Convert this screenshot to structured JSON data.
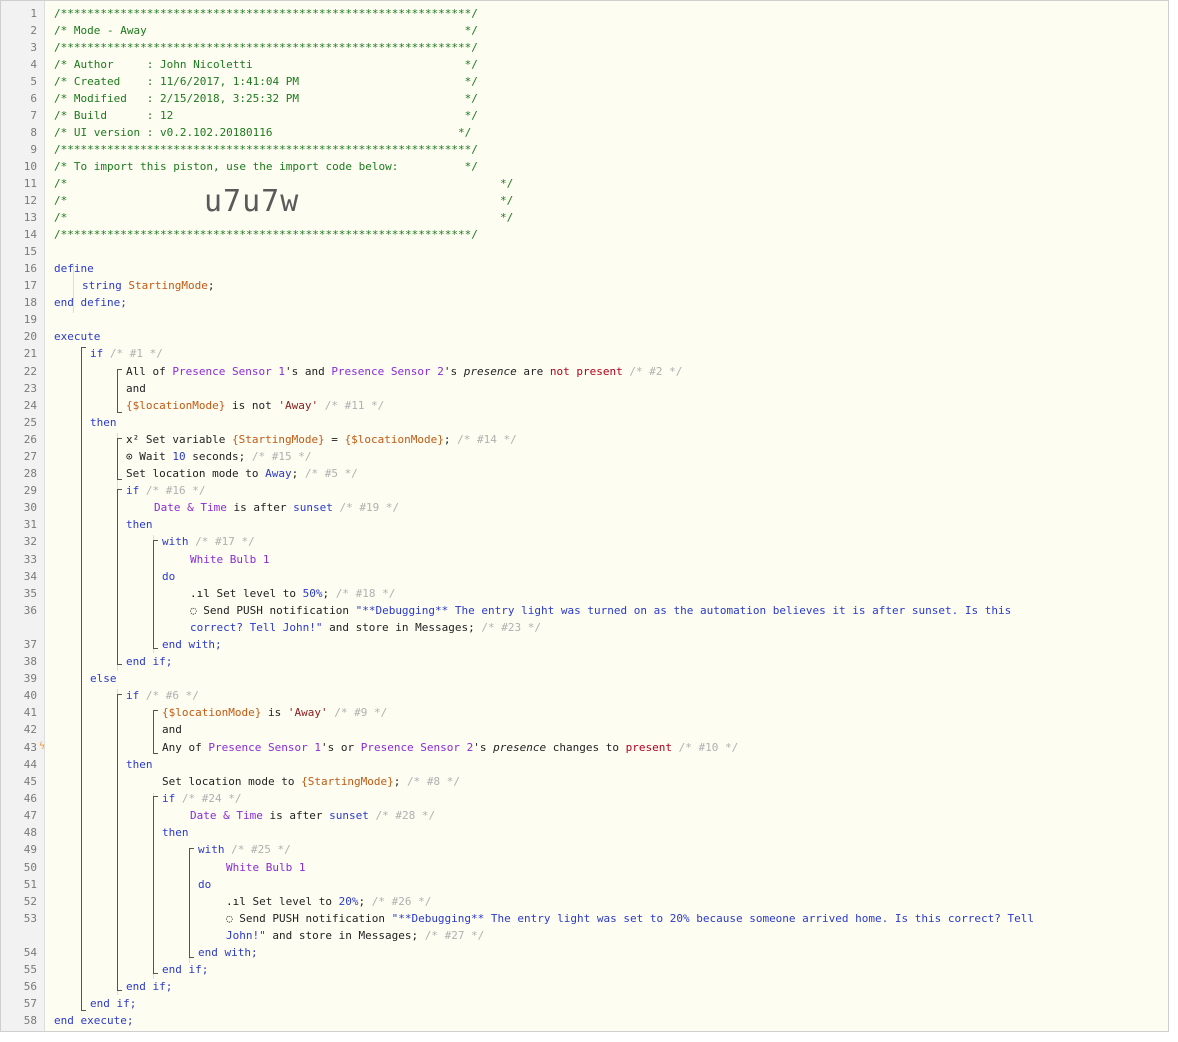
{
  "line_numbers": [
    "1",
    "2",
    "3",
    "4",
    "5",
    "6",
    "7",
    "8",
    "9",
    "10",
    "11",
    "12",
    "13",
    "14",
    "15",
    "16",
    "17",
    "18",
    "19",
    "20",
    "21",
    "22",
    "23",
    "24",
    "25",
    "26",
    "27",
    "28",
    "29",
    "30",
    "31",
    "32",
    "33",
    "34",
    "35",
    "36",
    "37",
    "38",
    "39",
    "40",
    "41",
    "42",
    "43",
    "44",
    "45",
    "46",
    "47",
    "48",
    "49",
    "50",
    "51",
    "52",
    "53",
    "54",
    "55",
    "56",
    "57",
    "58"
  ],
  "header": {
    "border": "/**************************************************************/",
    "title": "/* Mode - Away                                                */",
    "author": "/* Author     : John Nicoletti                                */",
    "created": "/* Created    : 11/6/2017, 1:41:04 PM                         */",
    "modified": "/* Modified   : 2/15/2018, 3:25:32 PM                         */",
    "build": "/* Build      : 12                                            */",
    "ui_version": "/* UI version : v0.2.102.20180116                            */",
    "import_text": "/* To import this piston, use the import code below:          */",
    "empty_left": "/*",
    "empty_right": "*/",
    "import_code": "u7u7w"
  },
  "code": {
    "define": "define",
    "string_type": "string",
    "starting_mode": "StartingMode",
    "semicolon": ";",
    "end_define": "end define;",
    "execute": "execute",
    "if": "if",
    "then": "then",
    "else": "else",
    "and": "and",
    "with": "with",
    "do": "do",
    "end_with": "end with;",
    "end_if": "end if;",
    "end_execute": "end execute;",
    "c1": "/* #1 */",
    "all_of": "All of ",
    "presence_sensor_1": "Presence Sensor 1",
    "s_and": "'s and ",
    "presence_sensor_2": "Presence Sensor 2",
    "s_presence": "'s ",
    "presence": "presence",
    "are": " are ",
    "not_present": "not present",
    "c2": "/* #2 */",
    "location_mode": "{$locationMode}",
    "is_not": " is not ",
    "away_str": "'Away'",
    "c11": "/* #11 */",
    "x2_icon": "x²",
    "set_variable": " Set variable ",
    "starting_mode_var": "{StartingMode}",
    "equals": " = ",
    "c14": "/* #14 */",
    "clock_icon": "⊙",
    "wait": " Wait ",
    "ten": "10",
    "seconds": " seconds;",
    "c15": "/* #15 */",
    "set_location_mode_to": "Set location mode to ",
    "away": "Away",
    "c5": "/* #5 */",
    "c16": "/* #16 */",
    "date_time": "Date & Time",
    "is_after": " is after ",
    "sunset": "sunset",
    "c19": "/* #19 */",
    "c17": "/* #17 */",
    "white_bulb_1": "White Bulb 1",
    "level_icon": ".ıl",
    "set_level_to": " Set level to ",
    "fifty": "50%",
    "c18": "/* #18 */",
    "chat_icon": "◌",
    "send_push": " Send PUSH notification ",
    "msg1a": "\"**Debugging** The entry light was turned on as the automation believes it is after sunset. Is this",
    "msg1b": "correct? Tell John!\"",
    "and_store": " and store in Messages;",
    "c23": "/* #23 */",
    "c6": "/* #6 */",
    "is": " is ",
    "c9": "/* #9 */",
    "any_of": "Any of ",
    "s_or": "'s or ",
    "changes_to": " changes to ",
    "present": "present",
    "c10": "/* #10 */",
    "c8": "/* #8 */",
    "c24": "/* #24 */",
    "c28": "/* #28 */",
    "c25": "/* #25 */",
    "twenty": "20%",
    "c26": "/* #26 */",
    "msg2a": "\"**Debugging** The entry light was set to 20% because someone arrived home. Is this correct? Tell",
    "msg2b": "John!\"",
    "c27": "/* #27 */",
    "bolt_icon": "ϟ"
  },
  "colors": {
    "comment": "#1d7a1d",
    "keyword": "#2b3ac8",
    "device": "#8a2bd6",
    "variable": "#c15a13",
    "string": "#8b1a1a",
    "operator": "#b3001b",
    "background": "#fdfdf2"
  }
}
